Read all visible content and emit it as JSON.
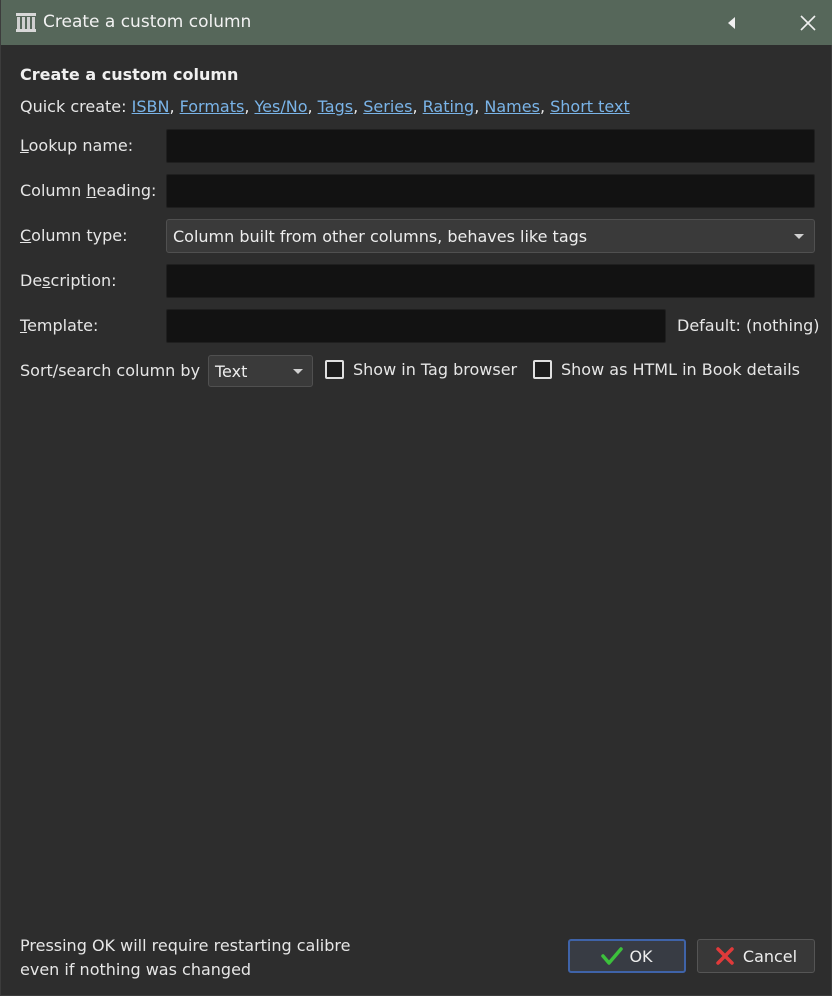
{
  "window": {
    "title": "Create a custom column"
  },
  "heading": "Create a custom column",
  "quick_create": {
    "label": "Quick create:",
    "links": [
      "ISBN",
      "Formats",
      "Yes/No",
      "Tags",
      "Series",
      "Rating",
      "Names",
      "Short text"
    ]
  },
  "form": {
    "lookup_name": {
      "label_pre": "",
      "label_mn": "L",
      "label_post": "ookup name:",
      "value": ""
    },
    "column_heading": {
      "label_pre": "Column ",
      "label_mn": "h",
      "label_post": "eading:",
      "value": ""
    },
    "column_type": {
      "label_pre": "",
      "label_mn": "C",
      "label_post": "olumn type:",
      "value": "Column built from other columns, behaves like tags"
    },
    "description": {
      "label_pre": "De",
      "label_mn": "s",
      "label_post": "cription:",
      "value": ""
    },
    "template": {
      "label_pre": "",
      "label_mn": "T",
      "label_post": "emplate:",
      "value": "",
      "default_text": "Default: (nothing)"
    },
    "sort_search": {
      "label": "Sort/search column by",
      "value": "Text"
    },
    "show_in_tag_browser": {
      "label": "Show in Tag browser",
      "checked": false
    },
    "show_as_html": {
      "label": "Show as HTML in Book details",
      "checked": false
    }
  },
  "footer": {
    "note_line1": "Pressing OK will require restarting calibre",
    "note_line2": "even if nothing was changed",
    "ok_label": "OK",
    "cancel_label": "Cancel"
  },
  "colors": {
    "titlebar": "#56675a",
    "background": "#2d2d2d",
    "link": "#7ab4e8",
    "field": "#121212"
  },
  "icons": {
    "app": "calibre-library-icon",
    "collapse": "triangle-left-icon",
    "close": "close-icon",
    "ok": "checkmark-icon",
    "cancel": "x-icon"
  }
}
